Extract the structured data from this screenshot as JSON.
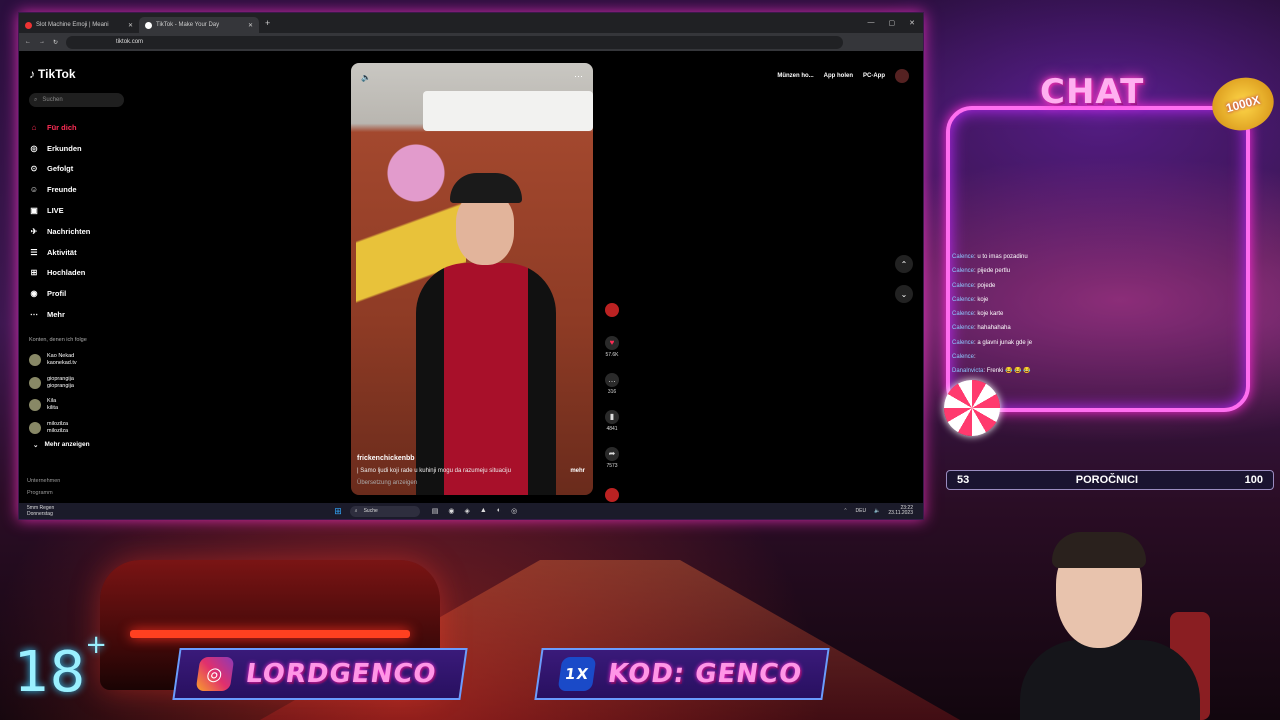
{
  "browser": {
    "tabs": [
      {
        "title": "Slot Machine Emoji | Meani"
      },
      {
        "title": "TikTok - Make Your Day"
      }
    ],
    "url": "tiktok.com"
  },
  "tiktok": {
    "logo": "TikTok",
    "search_placeholder": "Suchen",
    "nav": [
      {
        "label": "Für dich",
        "icon": "home-icon"
      },
      {
        "label": "Erkunden",
        "icon": "compass-icon"
      },
      {
        "label": "Gefolgt",
        "icon": "following-icon"
      },
      {
        "label": "Freunde",
        "icon": "friends-icon"
      },
      {
        "label": "LIVE",
        "icon": "live-icon"
      },
      {
        "label": "Nachrichten",
        "icon": "messages-icon"
      },
      {
        "label": "Aktivität",
        "icon": "activity-icon"
      },
      {
        "label": "Hochladen",
        "icon": "upload-icon"
      },
      {
        "label": "Profil",
        "icon": "profile-icon"
      },
      {
        "label": "Mehr",
        "icon": "more-icon"
      }
    ],
    "following_heading": "Konten, denen ich folge",
    "following": [
      {
        "name": "Kao Nekad",
        "handle": "kaonekad.tv"
      },
      {
        "name": "gioprangija",
        "handle": "gioprangija"
      },
      {
        "name": "Kila",
        "handle": "kilita"
      },
      {
        "name": "milozilza",
        "handle": "milozilza"
      }
    ],
    "show_more": "Mehr anzeigen",
    "footer": [
      "Unternehmen",
      "Programm"
    ],
    "top_right": [
      "Münzen ho...",
      "App holen",
      "PC-App"
    ],
    "video": {
      "username": "frickenchickenbb",
      "caption": "| Samo ljudi koji rade u kuhinji mogu da razumeju situaciju",
      "more": "mehr",
      "translate": "Übersetzung anzeigen"
    },
    "actions": [
      {
        "icon": "heart-icon",
        "count": "57.6K"
      },
      {
        "icon": "comment-icon",
        "count": "316"
      },
      {
        "icon": "bookmark-icon",
        "count": "4841"
      },
      {
        "icon": "share-icon",
        "count": "7573"
      }
    ]
  },
  "taskbar": {
    "weather_temp": "5mm Regen",
    "weather_day": "Donnerstag",
    "search": "Suche",
    "lang": "DEU",
    "time": "23:22",
    "date": "23.11.2023"
  },
  "overlay": {
    "chat_title": "CHAT",
    "badge": "1000X",
    "messages": [
      {
        "name": "Calence",
        "text": ": u to imas pozadinu"
      },
      {
        "name": "Calence",
        "text": ": pijede pertlu"
      },
      {
        "name": "Calence",
        "text": ": pojede"
      },
      {
        "name": "Calence",
        "text": ": koje"
      },
      {
        "name": "Calence",
        "text": ": koje karte"
      },
      {
        "name": "Calence",
        "text": ": hahahahaha"
      },
      {
        "name": "Calence",
        "text": ": a glavni junak gde je"
      },
      {
        "name": "Calence",
        "text": ": "
      },
      {
        "name": "Danalnvicta",
        "text": ": Frenki 😂 😂 😂"
      }
    ],
    "status_left": "53",
    "status_center": "POROČNICI",
    "status_right": "100",
    "age": "18",
    "age_plus": "+",
    "instagram": "LORDGENCO",
    "code_logo": "1X",
    "code": "KOD: GENCO"
  },
  "colors": {
    "accent": "#fe2c55",
    "neon": "#ff3cc8"
  }
}
